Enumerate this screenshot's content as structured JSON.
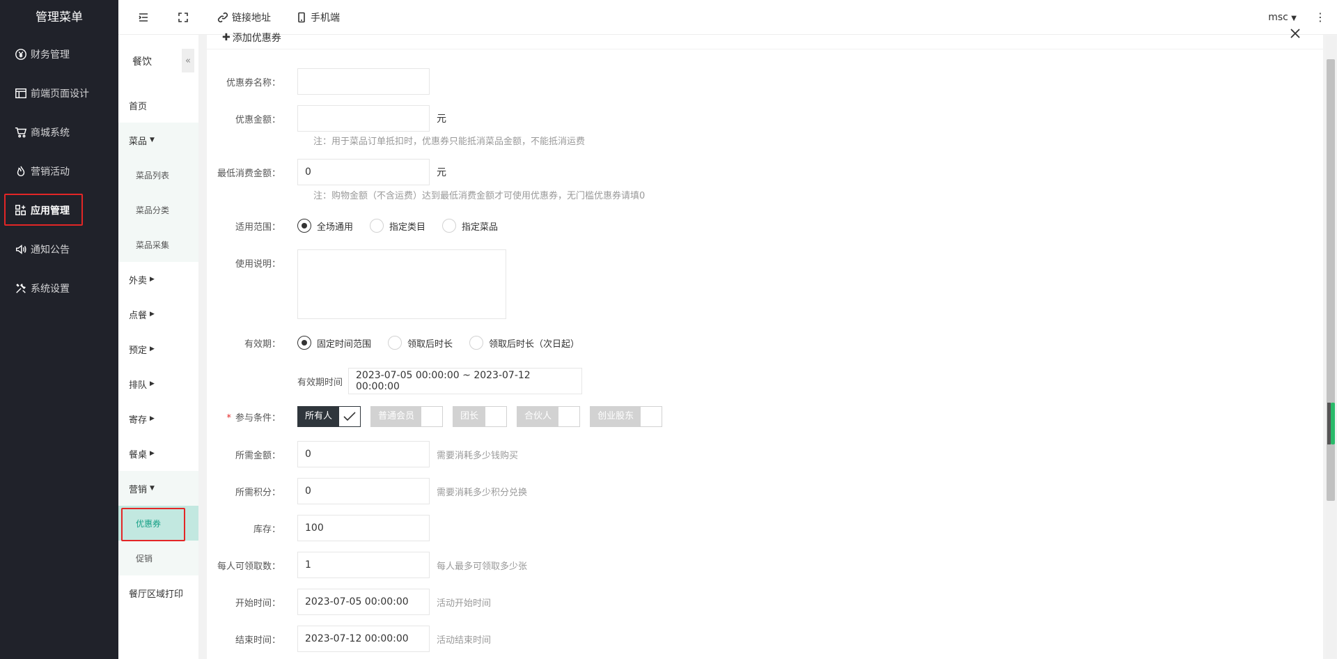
{
  "sidebar": {
    "title": "管理菜单",
    "items": [
      {
        "label": "财务管理",
        "icon": "yen-circle-icon"
      },
      {
        "label": "前端页面设计",
        "icon": "layout-icon"
      },
      {
        "label": "商城系统",
        "icon": "cart-icon"
      },
      {
        "label": "营销活动",
        "icon": "flame-icon"
      },
      {
        "label": "应用管理",
        "icon": "apps-icon"
      },
      {
        "label": "通知公告",
        "icon": "speaker-icon"
      },
      {
        "label": "系统设置",
        "icon": "tools-icon"
      }
    ]
  },
  "subnav": {
    "title": "餐饮",
    "collapse": "«",
    "items": {
      "home": "首页",
      "dishes": "菜品",
      "dish_list": "菜品列表",
      "dish_category": "菜品分类",
      "dish_collect": "菜品采集",
      "takeout": "外卖",
      "order": "点餐",
      "reserve": "预定",
      "queue": "排队",
      "storage": "寄存",
      "table": "餐桌",
      "marketing": "营销",
      "coupon": "优惠券",
      "promotion": "促销",
      "print": "餐厅区域打印"
    }
  },
  "topbar": {
    "link": "链接地址",
    "mobile": "手机端",
    "user": "msc",
    "more": "⋮"
  },
  "form": {
    "title": "添加优惠券",
    "name_label": "优惠券名称：",
    "name_value": "",
    "amount_label": "优惠金额：",
    "amount_value": "",
    "amount_unit": "元",
    "amount_note": "注：用于菜品订单抵扣时，优惠券只能抵消菜品金额，不能抵消运费",
    "min_label": "最低消费金额：",
    "min_value": "0",
    "min_unit": "元",
    "min_note": "注：购物金额（不含运费）达到最低消费金额才可使用优惠券，无门槛优惠券请填0",
    "scope_label": "适用范围：",
    "scope_options": [
      "全场通用",
      "指定类目",
      "指定菜品"
    ],
    "desc_label": "使用说明：",
    "valid_label": "有效期：",
    "valid_options": [
      "固定时间范围",
      "领取后时长",
      "领取后时长（次日起）"
    ],
    "valid_time_label": "有效期时间",
    "valid_time_value": "2023-07-05 00:00:00 ~ 2023-07-12 00:00:00",
    "cond_label": "参与条件：",
    "cond_required": "*",
    "cond_options": [
      "所有人",
      "普通会员",
      "团长",
      "合伙人",
      "创业股东"
    ],
    "need_amount_label": "所需金额：",
    "need_amount_value": "0",
    "need_amount_hint": "需要消耗多少钱购买",
    "need_points_label": "所需积分：",
    "need_points_value": "0",
    "need_points_hint": "需要消耗多少积分兑换",
    "stock_label": "库存：",
    "stock_value": "100",
    "per_label": "每人可领取数：",
    "per_value": "1",
    "per_hint": "每人最多可领取多少张",
    "start_label": "开始时间：",
    "start_value": "2023-07-05 00:00:00",
    "start_hint": "活动开始时间",
    "end_label": "结束时间：",
    "end_value": "2023-07-12 00:00:00",
    "end_hint": "活动结束时间"
  },
  "colors": {
    "sidebar_bg": "#20222a",
    "highlight": "#e32626",
    "active_sub_bg": "#c2e8e0",
    "active_sub_text": "#16a086",
    "checked_tag_bg": "#2f363c"
  }
}
